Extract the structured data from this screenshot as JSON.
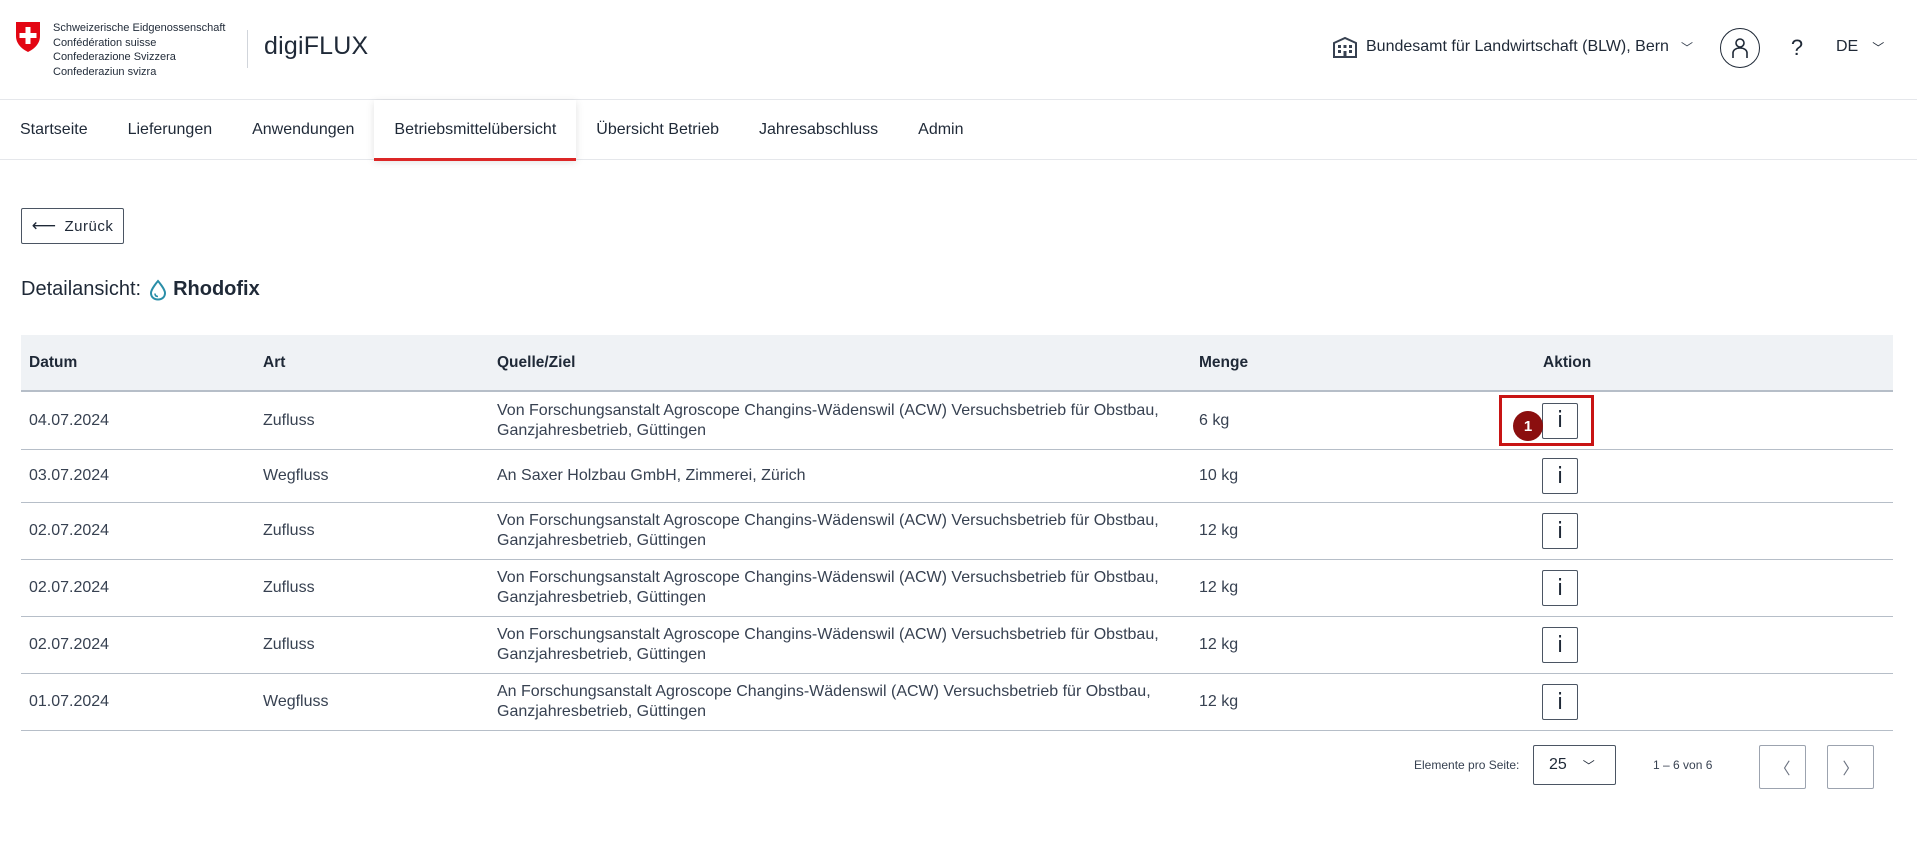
{
  "header": {
    "gov_lines": [
      "Schweizerische Eidgenossenschaft",
      "Confédération suisse",
      "Confederazione Svizzera",
      "Confederaziun svizra"
    ],
    "app_title": "digiFLUX",
    "organisation": "Bundesamt für Landwirtschaft (BLW), Bern",
    "help": "?",
    "language": "DE"
  },
  "nav": {
    "items": [
      "Startseite",
      "Lieferungen",
      "Anwendungen",
      "Betriebsmittelübersicht",
      "Übersicht Betrieb",
      "Jahresabschluss",
      "Admin"
    ],
    "active_index": 3
  },
  "back_button": "Zurück",
  "detail": {
    "label": "Detailansicht:",
    "product": "Rhodofix"
  },
  "table": {
    "headers": [
      "Datum",
      "Art",
      "Quelle/Ziel",
      "Menge",
      "Aktion"
    ],
    "info_icon": "i",
    "rows": [
      {
        "datum": "04.07.2024",
        "art": "Zufluss",
        "quelle_1": "Von Forschungsanstalt Agroscope Changins-Wädenswil (ACW) Versuchsbetrieb für Obstbau,",
        "quelle_2": "Ganzjahresbetrieb, Güttingen",
        "menge": "6 kg"
      },
      {
        "datum": "03.07.2024",
        "art": "Wegfluss",
        "quelle_1": "An Saxer Holzbau GmbH, Zimmerei, Zürich",
        "quelle_2": "",
        "menge": "10 kg"
      },
      {
        "datum": "02.07.2024",
        "art": "Zufluss",
        "quelle_1": "Von Forschungsanstalt Agroscope Changins-Wädenswil (ACW) Versuchsbetrieb für Obstbau,",
        "quelle_2": "Ganzjahresbetrieb, Güttingen",
        "menge": "12 kg"
      },
      {
        "datum": "02.07.2024",
        "art": "Zufluss",
        "quelle_1": "Von Forschungsanstalt Agroscope Changins-Wädenswil (ACW) Versuchsbetrieb für Obstbau,",
        "quelle_2": "Ganzjahresbetrieb, Güttingen",
        "menge": "12 kg"
      },
      {
        "datum": "02.07.2024",
        "art": "Zufluss",
        "quelle_1": "Von Forschungsanstalt Agroscope Changins-Wädenswil (ACW) Versuchsbetrieb für Obstbau,",
        "quelle_2": "Ganzjahresbetrieb, Güttingen",
        "menge": "12 kg"
      },
      {
        "datum": "01.07.2024",
        "art": "Wegfluss",
        "quelle_1": "An Forschungsanstalt Agroscope Changins-Wädenswil (ACW) Versuchsbetrieb für Obstbau,",
        "quelle_2": "Ganzjahresbetrieb, Güttingen",
        "menge": "12 kg"
      }
    ]
  },
  "annotation": {
    "step": "1",
    "color": "#c81414"
  },
  "pagination": {
    "per_page_label": "Elemente pro Seite:",
    "per_page_value": "25",
    "range": "1 – 6 von 6",
    "prev": "〈",
    "next": "〉"
  },
  "colors": {
    "accent_red": "#dc2626",
    "table_header_bg": "#eff2f5",
    "drop_icon": "#2a8ea8"
  }
}
